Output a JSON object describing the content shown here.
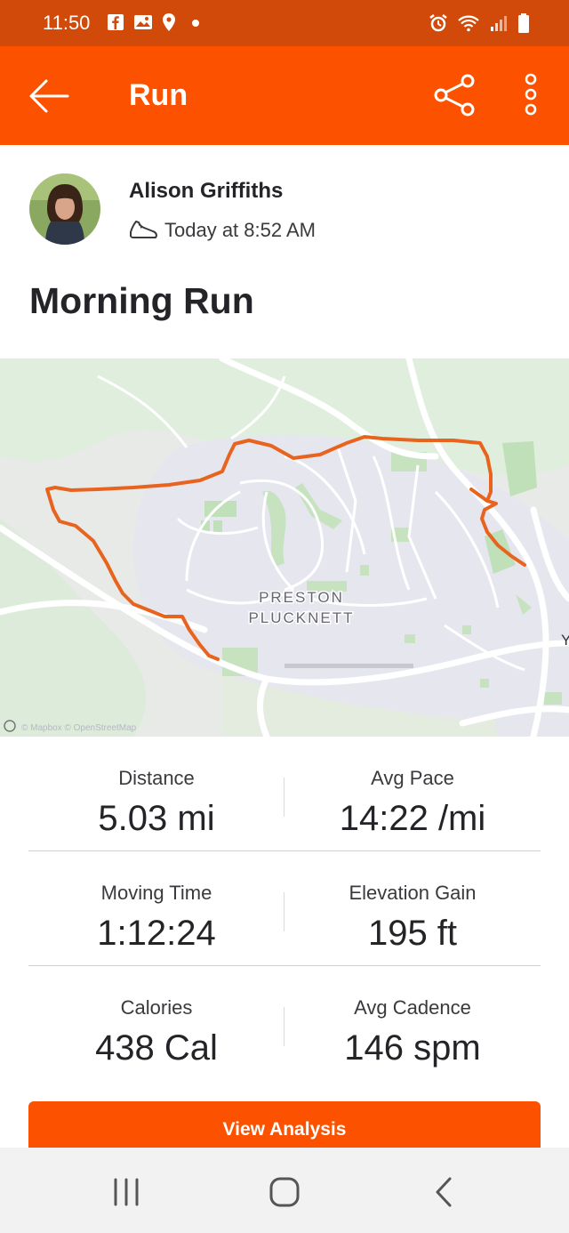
{
  "status_bar": {
    "time": "11:50",
    "left_icons": [
      "facebook-icon",
      "gallery-icon",
      "location-icon",
      "dot-icon"
    ],
    "right_icons": [
      "alarm-icon",
      "wifi-icon",
      "signal-icon",
      "battery-icon"
    ]
  },
  "app_bar": {
    "title": "Run",
    "back_icon": "back-arrow-icon",
    "share_icon": "share-icon",
    "more_icon": "more-vertical-icon"
  },
  "activity": {
    "athlete_name": "Alison Griffiths",
    "sport_icon": "shoe-icon",
    "timestamp": "Today at 8:52 AM",
    "title": "Morning Run"
  },
  "map": {
    "place_label_line1": "PRESTON",
    "place_label_line2": "PLUCKNETT",
    "edge_label": "Y",
    "attribution": "© Mapbox © OpenStreetMap",
    "route_color": "#e8641e"
  },
  "stats": [
    {
      "left": {
        "label": "Distance",
        "value": "5.03 mi"
      },
      "right": {
        "label": "Avg Pace",
        "value": "14:22 /mi"
      }
    },
    {
      "left": {
        "label": "Moving Time",
        "value": "1:12:24"
      },
      "right": {
        "label": "Elevation Gain",
        "value": "195 ft"
      }
    },
    {
      "left": {
        "label": "Calories",
        "value": "438 Cal"
      },
      "right": {
        "label": "Avg Cadence",
        "value": "146 spm"
      }
    }
  ],
  "actions": {
    "view_analysis": "View Analysis"
  },
  "colors": {
    "brand": "#fc5200",
    "status_bar": "#d14a0a"
  },
  "nav_bar": {
    "buttons": [
      "recent-apps-icon",
      "home-icon",
      "back-icon"
    ]
  }
}
